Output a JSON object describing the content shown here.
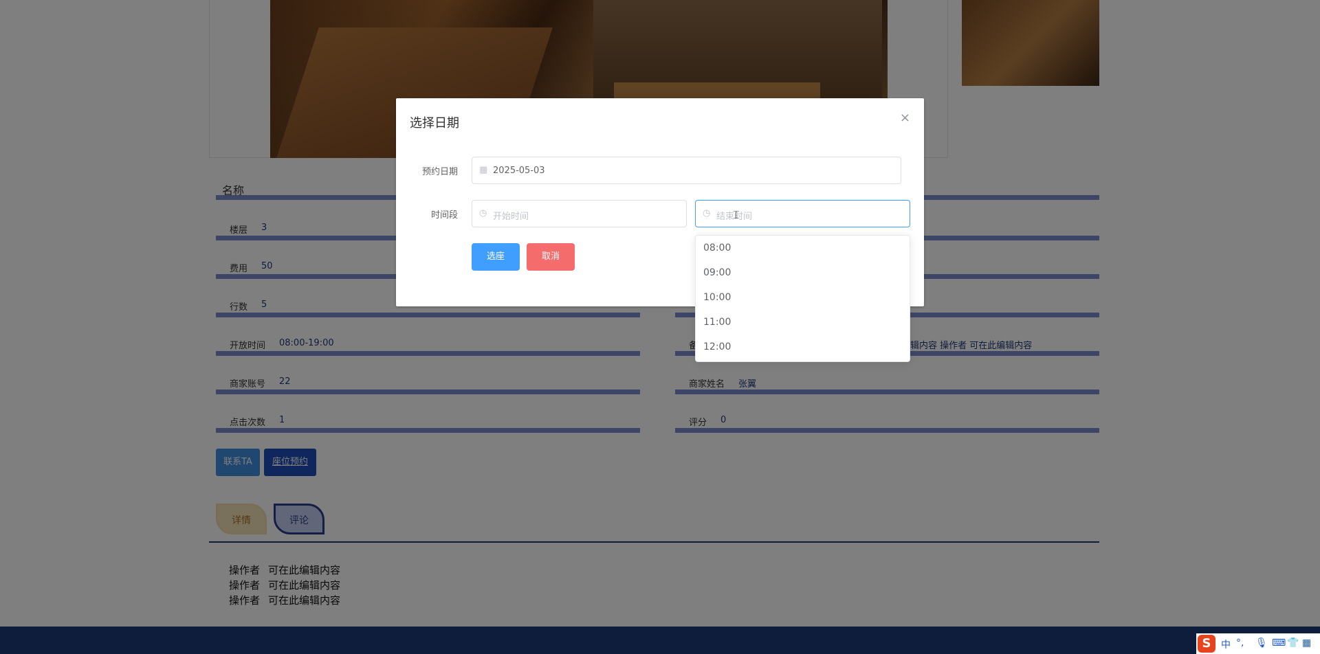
{
  "photos": {
    "main": "cafe-interior-photo",
    "side": "cafe-corner-photo"
  },
  "detail": {
    "name_label": "名称",
    "fields": [
      {
        "label": "楼层",
        "value": "3"
      },
      {
        "label": "费用",
        "value": "50"
      },
      {
        "label": "行数",
        "value": "5"
      },
      {
        "label": "开放时间",
        "value": "08:00-19:00"
      },
      {
        "label": "商家账号",
        "value": "22"
      },
      {
        "label": "点击次数",
        "value": "1"
      }
    ],
    "right_fields": [
      {
        "label": "备注",
        "value": "辑内容 操作者 可在此编辑内容"
      },
      {
        "label": "商家姓名",
        "value": "张翼"
      },
      {
        "label": "评分",
        "value": "0"
      }
    ]
  },
  "actions": {
    "contact": "联系TA",
    "reserve": "座位预约"
  },
  "tabs": {
    "detail": "详情",
    "comment": "评论"
  },
  "comments": [
    {
      "author": "操作者",
      "text": "可在此编辑内容"
    },
    {
      "author": "操作者",
      "text": "可在此编辑内容"
    },
    {
      "author": "操作者",
      "text": "可在此编辑内容"
    }
  ],
  "dialog": {
    "title": "选择日期",
    "close_icon": "×",
    "date_label": "预约日期",
    "date_value": "2025-05-03",
    "date_icon": "calendar-icon",
    "time_label": "时间段",
    "start_placeholder": "开始时间",
    "end_placeholder": "结束时间",
    "clock_icon": "clock-icon",
    "ok": "选座",
    "cancel": "取消"
  },
  "time_options": [
    "08:00",
    "09:00",
    "10:00",
    "11:00",
    "12:00"
  ],
  "tray": {
    "ime_logo": "S",
    "ime_lang": "中",
    "punct": "°,"
  },
  "colors": {
    "primary": "#409eff",
    "danger": "#f56c6c",
    "theme": "#1f3a78"
  }
}
